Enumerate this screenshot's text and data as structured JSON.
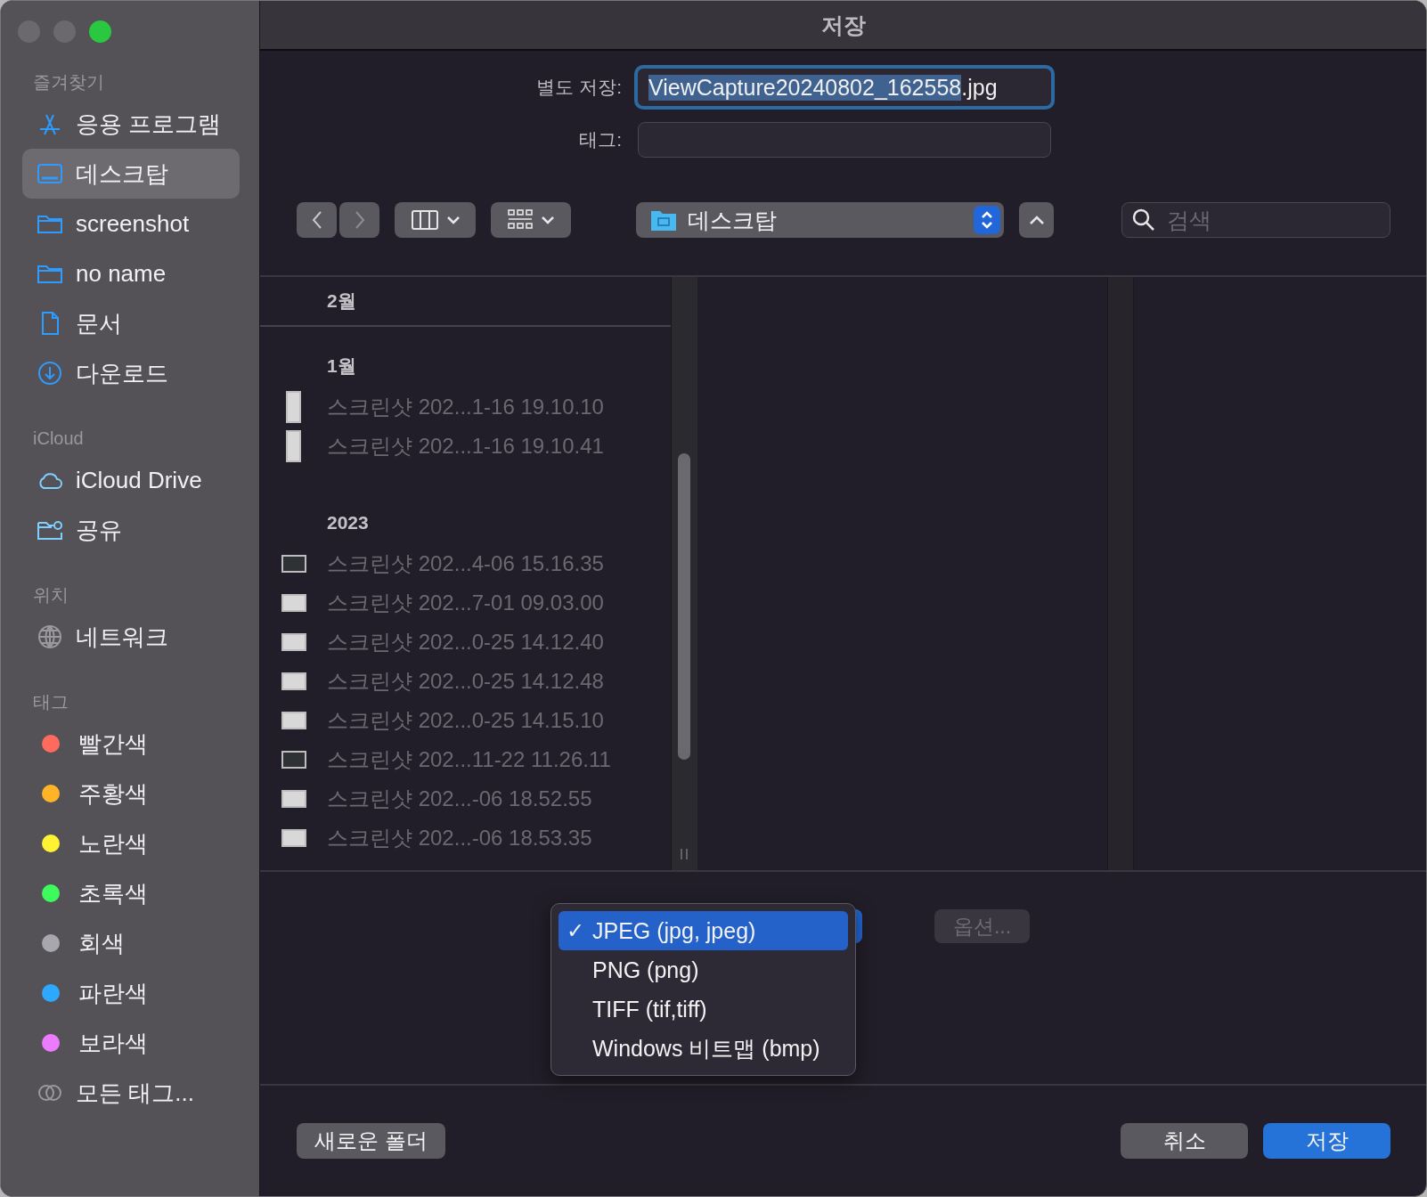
{
  "window": {
    "title": "저장"
  },
  "sidebar": {
    "sections": [
      {
        "heading": "즐겨찾기",
        "items": [
          {
            "label": "응용 프로그램",
            "kind": "apps",
            "selected": false
          },
          {
            "label": "데스크탑",
            "kind": "desktop",
            "selected": true
          },
          {
            "label": "screenshot",
            "kind": "folder",
            "selected": false
          },
          {
            "label": "no name",
            "kind": "folder",
            "selected": false
          },
          {
            "label": "문서",
            "kind": "document",
            "selected": false
          },
          {
            "label": "다운로드",
            "kind": "download",
            "selected": false
          }
        ]
      },
      {
        "heading": "iCloud",
        "items": [
          {
            "label": "iCloud Drive",
            "kind": "cloud",
            "selected": false
          },
          {
            "label": "공유",
            "kind": "shared",
            "selected": false
          }
        ]
      },
      {
        "heading": "위치",
        "items": [
          {
            "label": "네트워크",
            "kind": "network",
            "selected": false
          }
        ]
      },
      {
        "heading": "태그",
        "items": [
          {
            "label": "빨간색",
            "kind": "tag",
            "color": "#ff6a5f",
            "selected": false
          },
          {
            "label": "주황색",
            "kind": "tag",
            "color": "#ffb428",
            "selected": false
          },
          {
            "label": "노란색",
            "kind": "tag",
            "color": "#fff233",
            "selected": false
          },
          {
            "label": "초록색",
            "kind": "tag",
            "color": "#3dfb5c",
            "selected": false
          },
          {
            "label": "회색",
            "kind": "tag",
            "color": "#a9a7ae",
            "selected": false
          },
          {
            "label": "파란색",
            "kind": "tag",
            "color": "#2ea8ff",
            "selected": false
          },
          {
            "label": "보라색",
            "kind": "tag",
            "color": "#ec7bff",
            "selected": false
          },
          {
            "label": "모든 태그...",
            "kind": "all_tags",
            "selected": false
          }
        ]
      }
    ]
  },
  "form": {
    "save_as": {
      "label": "별도 저장:",
      "value_parts": [
        {
          "text": "ViewCapture20240802_162558",
          "selected": true
        },
        {
          "text": ".jpg",
          "selected": false
        }
      ]
    },
    "tags": {
      "label": "태그:"
    }
  },
  "toolbar": {
    "location": "데스크탑",
    "search": {
      "placeholder": "검색"
    }
  },
  "browser": {
    "groups": [
      {
        "heading": "2월",
        "pinned": true
      },
      {
        "heading": "1월",
        "pinned": false,
        "files": [
          {
            "name": "스크린샷 202...1-16 19.10.10",
            "kind": "portrait"
          },
          {
            "name": "스크린샷 202...1-16 19.10.41",
            "kind": "portrait"
          }
        ]
      },
      {
        "heading": "2023",
        "pinned": false,
        "files": [
          {
            "name": "스크린샷 202...4-06 15.16.35",
            "kind": "dark"
          },
          {
            "name": "스크린샷 202...7-01 09.03.00",
            "kind": "light"
          },
          {
            "name": "스크린샷 202...0-25 14.12.40",
            "kind": "light"
          },
          {
            "name": "스크린샷 202...0-25 14.12.48",
            "kind": "light"
          },
          {
            "name": "스크린샷 202...0-25 14.15.10",
            "kind": "light"
          },
          {
            "name": "스크린샷 202...11-22 11.26.11",
            "kind": "dark"
          },
          {
            "name": "스크린샷 202...-06 18.52.55",
            "kind": "light"
          },
          {
            "name": "스크린샷 202...-06 18.53.35",
            "kind": "light"
          }
        ]
      }
    ]
  },
  "format_menu": {
    "options": [
      {
        "label": "JPEG (jpg, jpeg)",
        "selected": true,
        "mark": "✓"
      },
      {
        "label": "PNG (png)",
        "selected": false
      },
      {
        "label": "TIFF (tif,tiff)",
        "selected": false
      },
      {
        "label": "Windows 비트맵 (bmp)",
        "selected": false
      }
    ]
  },
  "options_button": {
    "label": "옵션...",
    "disabled": true
  },
  "buttons": {
    "new_folder": "새로운 폴더",
    "cancel": "취소",
    "save": "저장"
  }
}
